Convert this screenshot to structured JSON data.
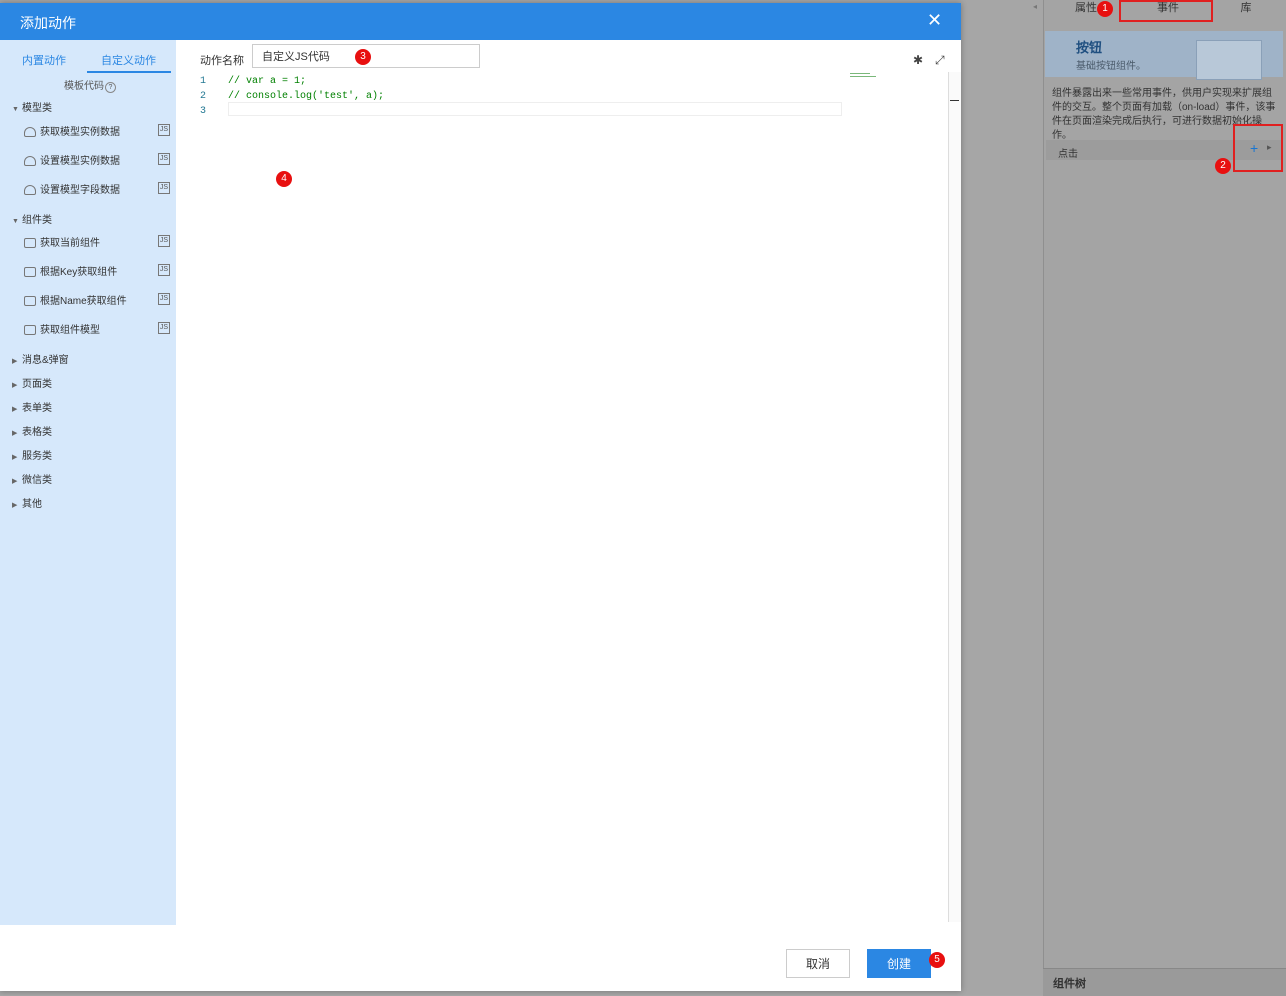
{
  "dialog": {
    "title": "添加动作",
    "close_icon": "✕",
    "tabs": [
      {
        "label": "内置动作"
      },
      {
        "label": "自定义动作"
      }
    ],
    "template_label": "模板代码",
    "help_icon": "?",
    "groups": [
      {
        "label": "模型类",
        "items": [
          "获取模型实例数据",
          "设置模型实例数据",
          "设置模型字段数据"
        ]
      },
      {
        "label": "组件类",
        "items": [
          "获取当前组件",
          "根据Key获取组件",
          "根据Name获取组件",
          "获取组件模型"
        ]
      },
      {
        "label": "消息&弹窗"
      },
      {
        "label": "页面类"
      },
      {
        "label": "表单类"
      },
      {
        "label": "表格类"
      },
      {
        "label": "服务类"
      },
      {
        "label": "微信类"
      },
      {
        "label": "其他"
      }
    ],
    "js_tag": "JS",
    "action_name_label": "动作名称",
    "action_name_value": "自定义JS代码",
    "bug_icon": "✱",
    "expand_icon": "⤢",
    "code_lines": [
      {
        "num": "1",
        "text": "// var a = 1;"
      },
      {
        "num": "2",
        "text": "// console.log('test', a);"
      },
      {
        "num": "3",
        "text": ""
      }
    ],
    "cancel_label": "取消",
    "create_label": "创建"
  },
  "right_panel": {
    "tabs": [
      {
        "label": "属性"
      },
      {
        "label": "事件"
      },
      {
        "label": "库"
      }
    ],
    "banner_title": "按钮",
    "banner_subtitle": "基础按钮组件。",
    "description": "组件暴露出来一些常用事件，供用户实现来扩展组件的交互。整个页面有加载（on-load）事件，该事件在页面渲染完成后执行，可进行数据初始化操作。",
    "event_label": "点击",
    "add_icon": "+",
    "component_tree_label": "组件树"
  },
  "badges": [
    "1",
    "2",
    "3",
    "4",
    "5"
  ],
  "colors": {
    "accent": "#2b87e3",
    "highlight": "#e02020"
  }
}
